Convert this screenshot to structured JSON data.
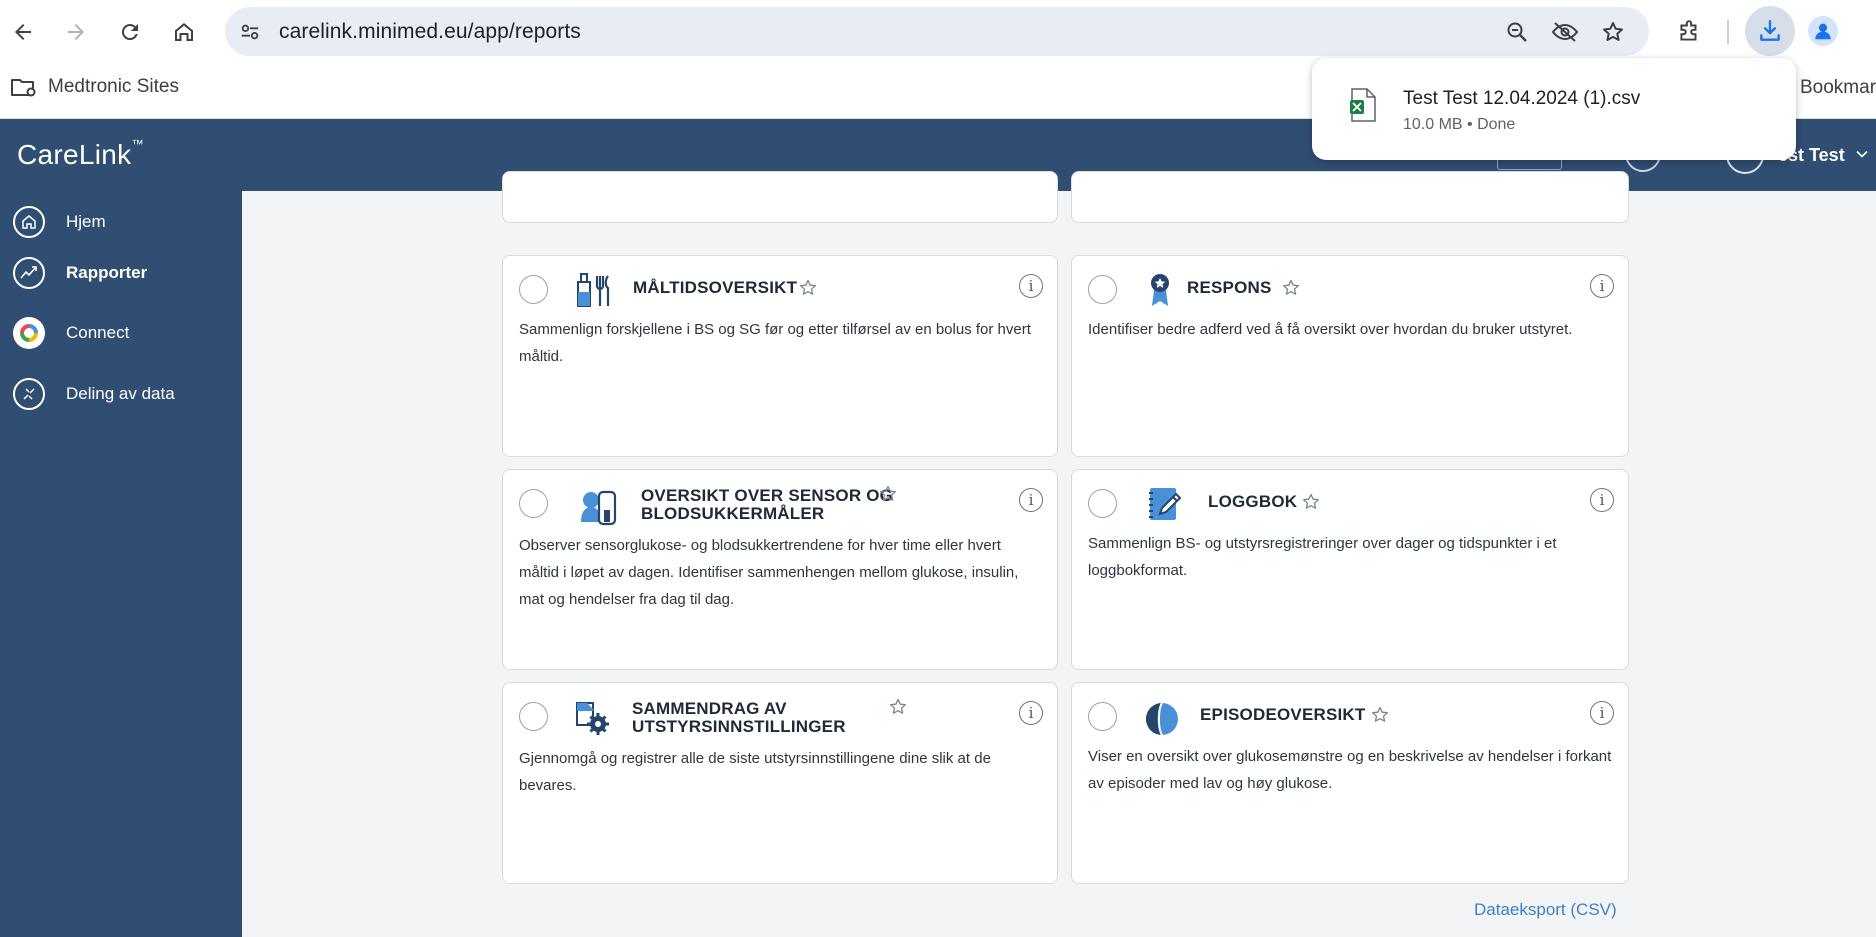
{
  "browser": {
    "url": "carelink.minimed.eu/app/reports",
    "bookmark_folder": "Medtronic Sites",
    "bookmark_right": "Bookmark"
  },
  "download": {
    "file_name": "Test Test 12.04.2024 (1).csv",
    "size": "10.0 MB",
    "status": "Done",
    "meta": "10.0 MB • Done"
  },
  "app": {
    "logo": "CareLink",
    "logo_tm": "™",
    "user": "est Test"
  },
  "sidebar": {
    "items": [
      {
        "label": "Hjem",
        "icon": "home-icon"
      },
      {
        "label": "Rapporter",
        "icon": "trend-icon"
      },
      {
        "label": "Connect",
        "icon": "connect-icon"
      },
      {
        "label": "Deling av data",
        "icon": "share-icon"
      }
    ]
  },
  "reports": [
    {
      "title": "MÅLTIDSOVERSIKT",
      "desc": "Sammenlign forskjellene i BS og SG før og etter tilførsel av en bolus for hvert måltid.",
      "icon": "meal-icon"
    },
    {
      "title": "RESPONS",
      "desc": "Identifiser bedre adferd ved å få oversikt over hvordan du bruker utstyret.",
      "icon": "ribbon-icon"
    },
    {
      "title_line1": "OVERSIKT OVER SENSOR OG",
      "title_line2": "BLODSUKKERMÅLER",
      "desc": "Observer sensorglukose- og blodsukkertrendene for hver time eller hvert måltid i løpet av dagen. Identifiser sammenhengen mellom glukose, insulin, mat og hendelser fra dag til dag.",
      "icon": "sensor-meter-icon"
    },
    {
      "title": "LOGGBOK",
      "desc": "Sammenlign BS- og utstyrsregistreringer over dager og tidspunkter i et loggbokformat.",
      "icon": "logbook-icon"
    },
    {
      "title_line1": "SAMMENDRAG AV",
      "title_line2": "UTSTYRSINNSTILLINGER",
      "desc": "Gjennomgå og registrer alle de siste utstyrsinnstillingene dine slik at de bevares.",
      "icon": "device-settings-icon"
    },
    {
      "title": "EPISODEOVERSIKT",
      "desc": "Viser en oversikt over glukosemønstre og en beskrivelse av hendelser i forkant av episoder med lav og høy glukose.",
      "icon": "episode-icon"
    }
  ],
  "footer": {
    "csv_export": "Dataeksport (CSV)"
  },
  "colors": {
    "header": "#304e72",
    "accent": "#3b82c4",
    "download_blue": "#1a73e8"
  }
}
